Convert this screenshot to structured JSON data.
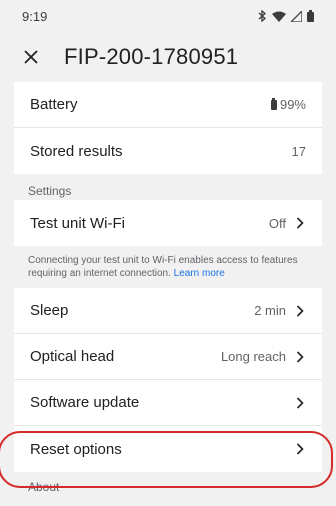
{
  "status_bar": {
    "time": "9:19",
    "icons": [
      "bluetooth-icon",
      "wifi-icon",
      "signal-icon",
      "battery-icon"
    ]
  },
  "header": {
    "title": "FIP-200-1780951",
    "close_icon": "close-icon"
  },
  "device_info": [
    {
      "label": "Battery",
      "value": "99%"
    },
    {
      "label": "Stored results",
      "value": "17"
    }
  ],
  "settings": {
    "header": "Settings",
    "wifi": {
      "label": "Test unit Wi-Fi",
      "value": "Off"
    },
    "wifi_info": "Connecting your test unit to Wi-Fi enables access to features requiring an internet connection.",
    "learn_more": "Learn more",
    "items": [
      {
        "label": "Sleep",
        "value": "2 min"
      },
      {
        "label": "Optical head",
        "value": "Long reach"
      },
      {
        "label": "Software update",
        "value": ""
      },
      {
        "label": "Reset options",
        "value": ""
      }
    ]
  },
  "about": {
    "header": "About"
  },
  "colors": {
    "accent": "#1a73e8",
    "highlight": "#d42a2a",
    "background": "#f1f1f1"
  }
}
